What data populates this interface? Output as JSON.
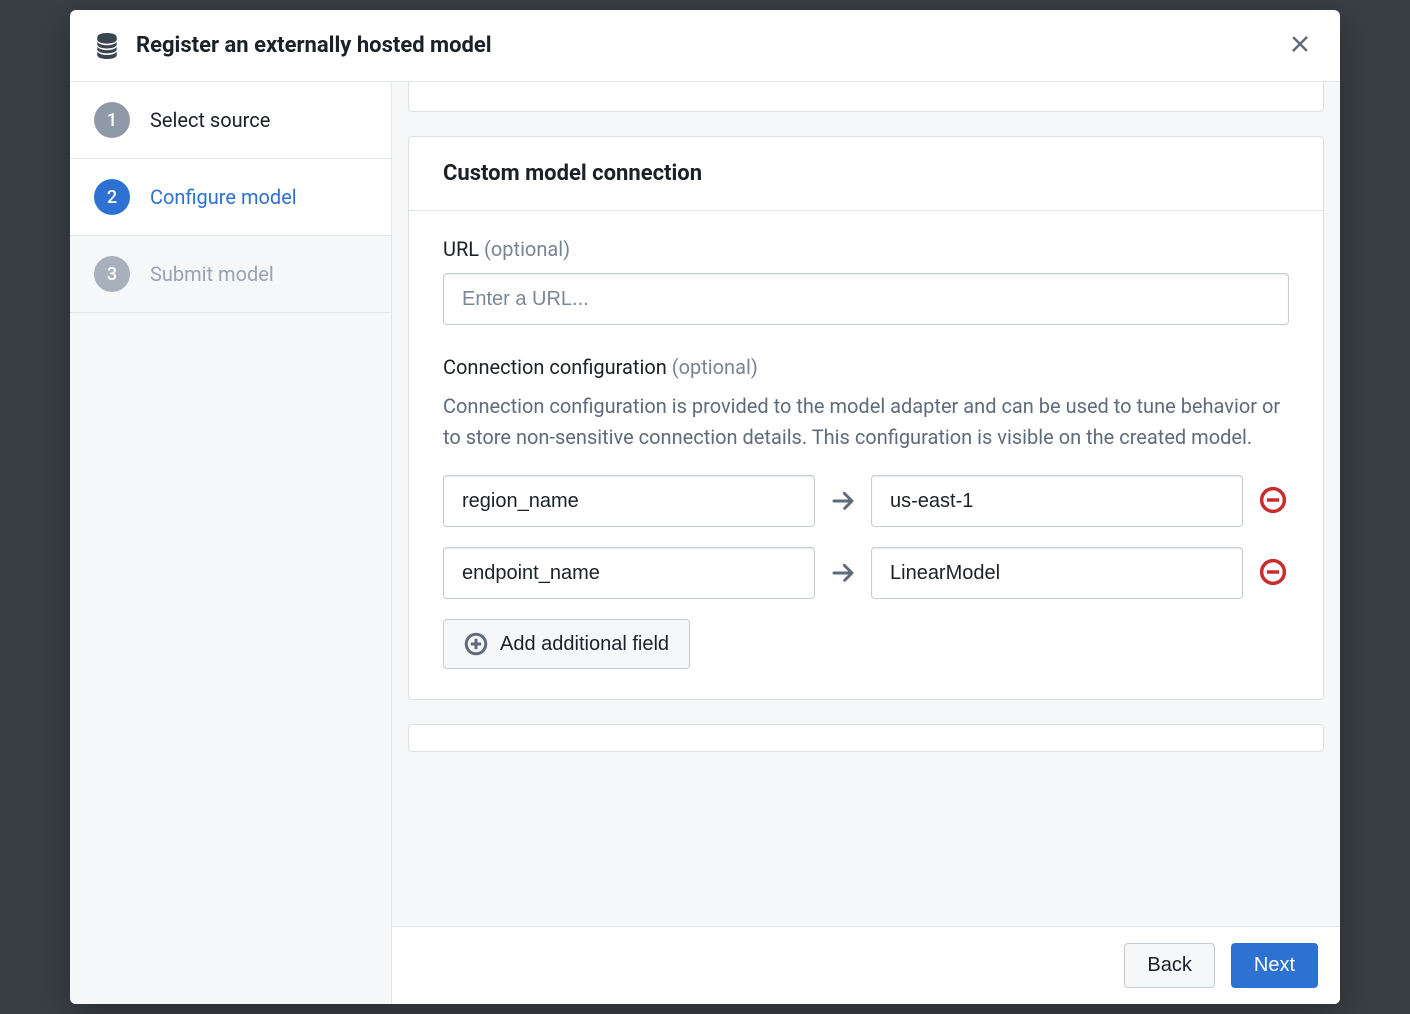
{
  "dialog": {
    "title": "Register an externally hosted model"
  },
  "steps": [
    {
      "number": "1",
      "label": "Select source"
    },
    {
      "number": "2",
      "label": "Configure model"
    },
    {
      "number": "3",
      "label": "Submit model"
    }
  ],
  "panel": {
    "title": "Custom model connection",
    "url": {
      "label": "URL",
      "optional": "(optional)",
      "placeholder": "Enter a URL...",
      "value": ""
    },
    "config": {
      "label": "Connection configuration",
      "optional": "(optional)",
      "help": "Connection configuration is provided to the model adapter and can be used to tune behavior or to store non-sensitive connection details. This configuration is visible on the created model.",
      "rows": [
        {
          "key": "region_name",
          "value": "us-east-1"
        },
        {
          "key": "endpoint_name",
          "value": "LinearModel"
        }
      ],
      "add_label": "Add additional field"
    }
  },
  "footer": {
    "back": "Back",
    "next": "Next"
  }
}
